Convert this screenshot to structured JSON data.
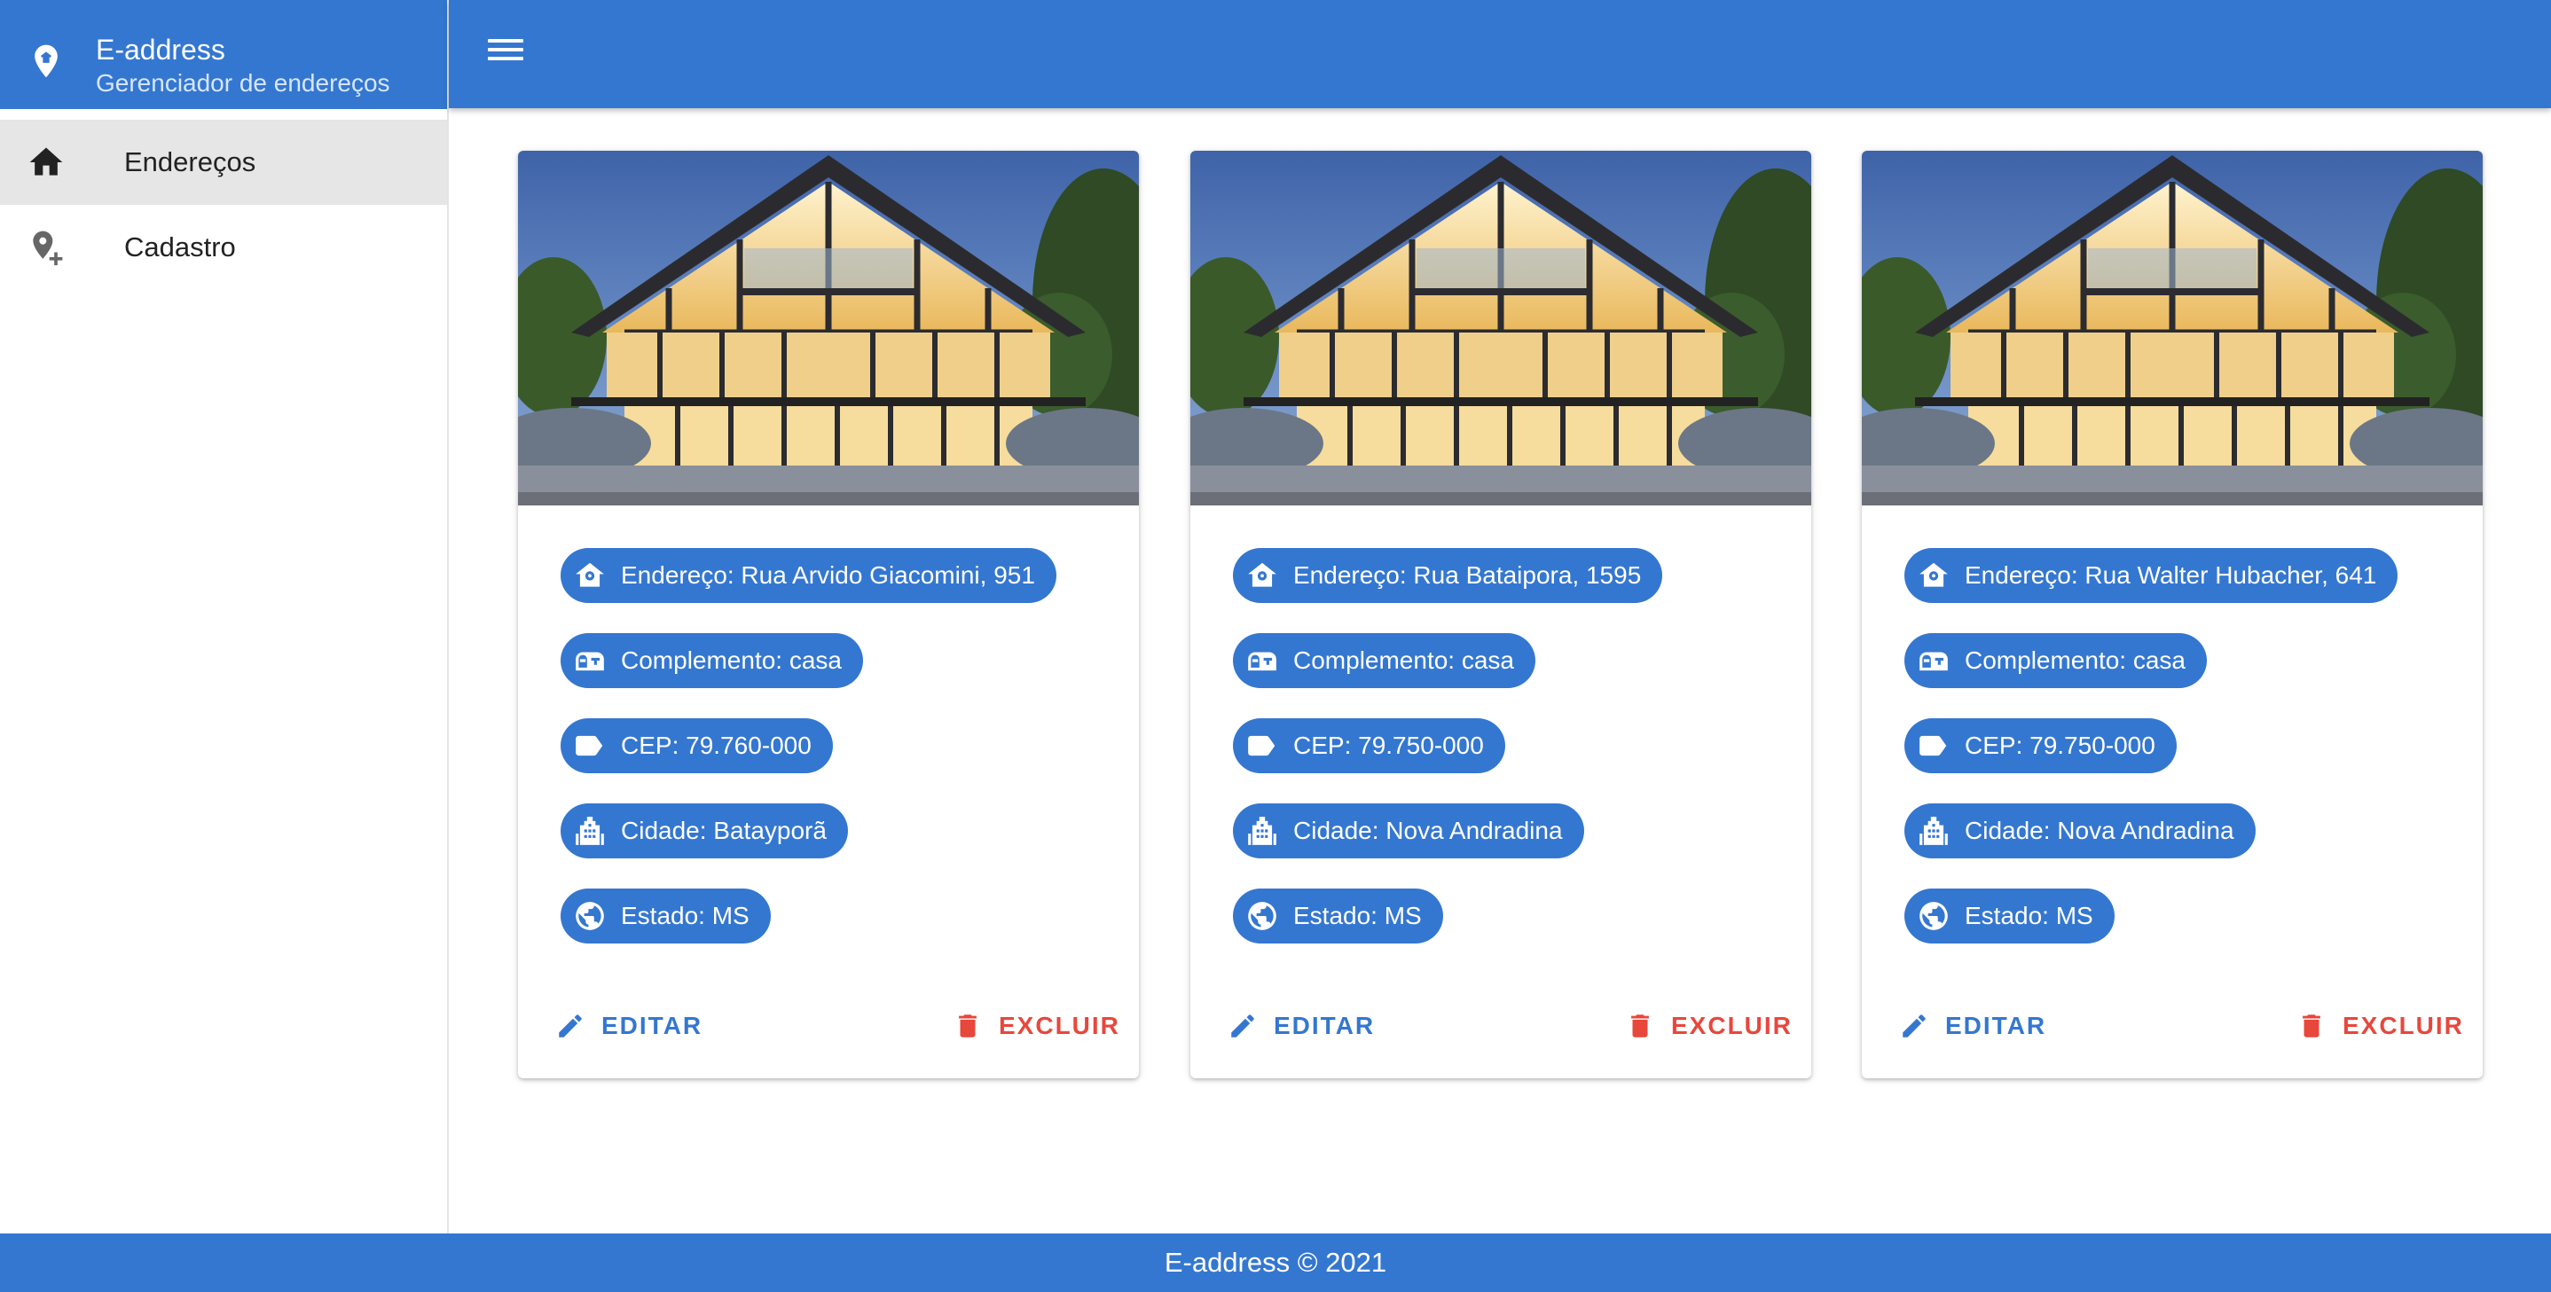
{
  "brand": {
    "title": "E-address",
    "subtitle": "Gerenciador de endereços"
  },
  "sidebar": {
    "items": [
      {
        "label": "Endereços",
        "icon": "home-icon",
        "active": true
      },
      {
        "label": "Cadastro",
        "icon": "add-location-icon",
        "active": false
      }
    ]
  },
  "appbar": {
    "menu_icon": "menu-icon"
  },
  "cards": [
    {
      "endereco": "Endereço: Rua Arvido Giacomini, 951",
      "complemento": "Complemento: casa",
      "cep": "CEP: 79.760-000",
      "cidade": "Cidade: Batayporã",
      "estado": "Estado: MS",
      "edit_label": "EDITAR",
      "delete_label": "EXCLUIR"
    },
    {
      "endereco": "Endereço: Rua Bataipora, 1595",
      "complemento": "Complemento: casa",
      "cep": "CEP: 79.750-000",
      "cidade": "Cidade: Nova Andradina",
      "estado": "Estado: MS",
      "edit_label": "EDITAR",
      "delete_label": "EXCLUIR"
    },
    {
      "endereco": "Endereço: Rua Walter Hubacher, 641",
      "complemento": "Complemento: casa",
      "cep": "CEP: 79.750-000",
      "cidade": "Cidade: Nova Andradina",
      "estado": "Estado: MS",
      "edit_label": "EDITAR",
      "delete_label": "EXCLUIR"
    }
  ],
  "footer": {
    "text": "E-address © 2021"
  },
  "colors": {
    "primary": "#3477d0",
    "danger": "#e8473c",
    "active_nav": "#e6e6e6"
  }
}
